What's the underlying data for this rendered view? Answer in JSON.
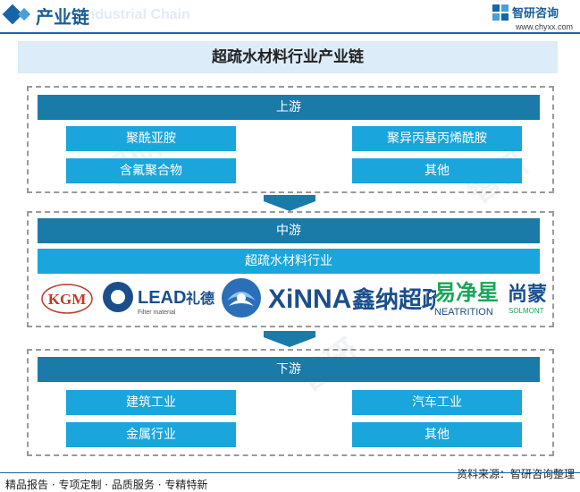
{
  "header": {
    "title": "产业链",
    "ghost_text": "Industrial Chain",
    "brand_name": "智研咨询",
    "brand_url": "www.chyxx.com"
  },
  "diagram_title": "超疏水材料行业产业链",
  "upstream": {
    "label": "上游",
    "items": [
      "聚酰亚胺",
      "聚异丙基丙烯酰胺",
      "含氟聚合物",
      "其他"
    ]
  },
  "midstream": {
    "label": "中游",
    "industry": "超疏水材料行业",
    "logos": {
      "kgm": "KGM",
      "lead": "LEAD",
      "lead_cn": "礼德",
      "lead_sub": "Filter material",
      "xinna": "XiNNA",
      "xinna_cn": "鑫纳超疏",
      "neatrition_cn": "易净星",
      "neatrition": "NEATRITION",
      "solmont_cn": "尚蒙",
      "solmont": "SOLMONT"
    }
  },
  "downstream": {
    "label": "下游",
    "items": [
      "建筑工业",
      "汽车工业",
      "金属行业",
      "其他"
    ]
  },
  "footer": {
    "left": "精品报告 · 专项定制 · 品质服务 · 专精特新",
    "right": "资料来源：智研咨询整理"
  },
  "colors": {
    "dark_band": "#1a7aa8",
    "light_box": "#1aa5dc",
    "brand": "#1565a8"
  }
}
